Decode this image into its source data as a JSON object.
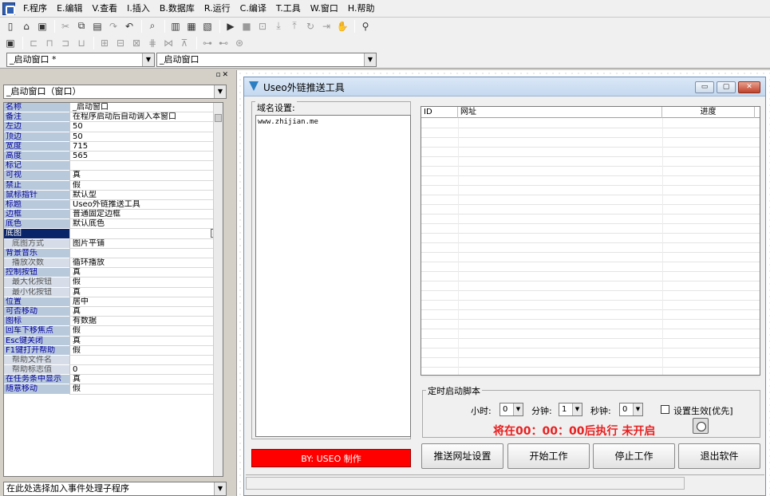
{
  "menu": [
    "F.程序",
    "E.编辑",
    "V.查看",
    "I.插入",
    "B.数据库",
    "R.运行",
    "C.编译",
    "T.工具",
    "W.窗口",
    "H.帮助"
  ],
  "toolbar1": {
    "icons": [
      "new-file-icon",
      "open-folder-icon",
      "save-icon",
      "cut-icon",
      "copy-icon",
      "paste-icon",
      "redo-icon",
      "undo-icon",
      "find-icon",
      "layout-icon",
      "split-icon",
      "window-icon",
      "run-icon",
      "stop-icon",
      "step-icon",
      "step-into-icon",
      "step-out-icon",
      "step-over-icon",
      "run-to-cursor-icon",
      "hand-icon",
      "binoculars-icon"
    ]
  },
  "toolbar2": {
    "icons": [
      "form-icon",
      "align-left-icon",
      "align-center-icon",
      "align-right-icon",
      "same-size-icon",
      "grid-icon",
      "center-h-icon",
      "center-v-icon",
      "distribute-icon",
      "space-icon",
      "width-icon",
      "height-icon",
      "tab-order-icon"
    ]
  },
  "combo_row": {
    "window_select": "_启动窗口 *",
    "object_select": "_启动窗口"
  },
  "panel": {
    "object_select": "_启动窗口（窗口）",
    "properties": [
      {
        "name": "名称",
        "value": "_启动窗口"
      },
      {
        "name": "备注",
        "value": "在程序启动后自动调入本窗口"
      },
      {
        "name": "左边",
        "value": "50"
      },
      {
        "name": "顶边",
        "value": "50"
      },
      {
        "name": "宽度",
        "value": "715"
      },
      {
        "name": "高度",
        "value": "565"
      },
      {
        "name": "标记",
        "value": ""
      },
      {
        "name": "可视",
        "value": "真"
      },
      {
        "name": "禁止",
        "value": "假"
      },
      {
        "name": "鼠标指针",
        "value": "默认型"
      },
      {
        "name": "标题",
        "value": "Useo外链推送工具"
      },
      {
        "name": "边框",
        "value": "普通固定边框"
      },
      {
        "name": "底色",
        "value": "默认底色"
      },
      {
        "name": "底图",
        "value": "",
        "selected": true
      },
      {
        "name": "底图方式",
        "value": "图片平铺",
        "sub": true
      },
      {
        "name": "背景音乐",
        "value": ""
      },
      {
        "name": "播放次数",
        "value": "循环播放",
        "sub": true
      },
      {
        "name": "控制按钮",
        "value": "真"
      },
      {
        "name": "最大化按钮",
        "value": "假",
        "sub": true
      },
      {
        "name": "最小化按钮",
        "value": "真",
        "sub": true
      },
      {
        "name": "位置",
        "value": "居中"
      },
      {
        "name": "可否移动",
        "value": "真"
      },
      {
        "name": "图标",
        "value": "有数据"
      },
      {
        "name": "回车下移焦点",
        "value": "假"
      },
      {
        "name": "Esc键关闭",
        "value": "真"
      },
      {
        "name": "F1键打开帮助",
        "value": "假"
      },
      {
        "name": "帮助文件名",
        "value": "",
        "sub": true
      },
      {
        "name": "帮助标志值",
        "value": "0",
        "sub": true
      },
      {
        "name": "在任务条中显示",
        "value": "真"
      },
      {
        "name": "随意移动",
        "value": "假"
      }
    ],
    "event_select": "在此处选择加入事件处理子程序"
  },
  "designed_window": {
    "title": "Useo外链推送工具",
    "domain_group_label": "域名设置:",
    "domain_text": "www.zhijian.me",
    "list_columns": [
      "ID",
      "网址",
      "进度"
    ],
    "timer_group_label": "定时启动脚本",
    "hour_label": "小时:",
    "hour_value": "0",
    "minute_label": "分钟:",
    "minute_value": "1",
    "second_label": "秒钟:",
    "second_value": "0",
    "effective_label": "设置生效[优先]",
    "countdown": "将在00：00：00后执行 未开启",
    "credit": "BY: USEO 制作",
    "buttons": [
      "推送网址设置",
      "开始工作",
      "停止工作",
      "退出软件"
    ]
  },
  "colors": {
    "credit_bg": "#ff0000",
    "countdown_text": "#e82020",
    "prop_name_bg": "#b9c9dc",
    "selected_bg": "#0a246a"
  }
}
